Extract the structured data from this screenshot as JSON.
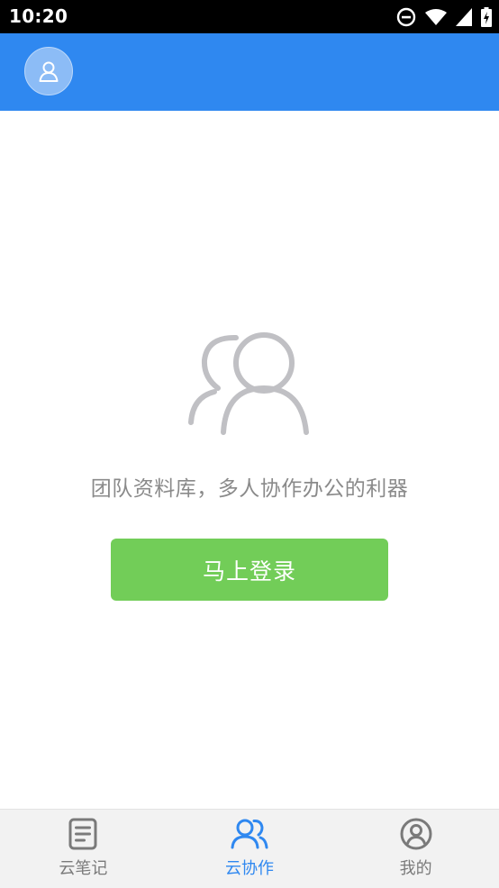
{
  "status_bar": {
    "time": "10:20",
    "icons": [
      "do-not-disturb-icon",
      "wifi-icon",
      "signal-icon",
      "battery-charging-icon"
    ]
  },
  "header": {
    "avatar_icon": "user-avatar-icon"
  },
  "main": {
    "illustration_icon": "team-users-icon",
    "empty_text": "团队资料库，多人协作办公的利器",
    "login_button_label": "马上登录"
  },
  "bottom_nav": {
    "items": [
      {
        "label": "云笔记",
        "icon": "note-icon",
        "active": false
      },
      {
        "label": "云协作",
        "icon": "team-icon",
        "active": true
      },
      {
        "label": "我的",
        "icon": "profile-icon",
        "active": false
      }
    ]
  },
  "colors": {
    "header": "#2f88f0",
    "accent": "#2f88f0",
    "login_button": "#72cd58",
    "text_muted": "#8a8a8a",
    "nav_background": "#f2f2f2"
  }
}
